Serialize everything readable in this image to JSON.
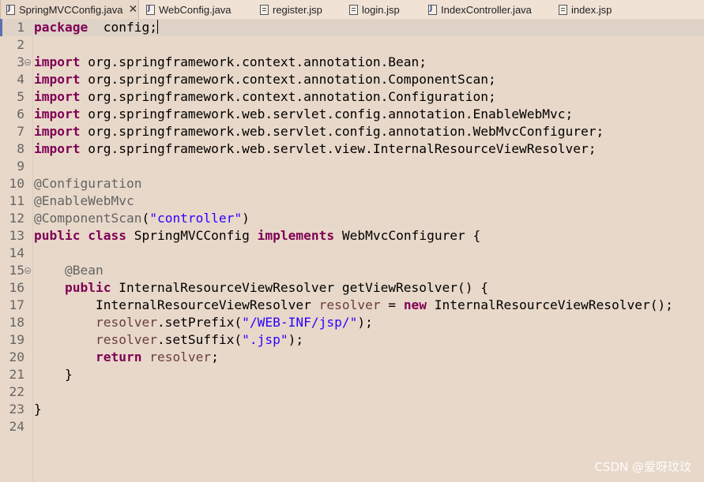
{
  "tabs": [
    {
      "label": "SpringMVCConfig.java",
      "type": "java",
      "active": true
    },
    {
      "label": "WebConfig.java",
      "type": "java"
    },
    {
      "label": "register.jsp",
      "type": "jsp"
    },
    {
      "label": "login.jsp",
      "type": "jsp"
    },
    {
      "label": "IndexController.java",
      "type": "java"
    },
    {
      "label": "index.jsp",
      "type": "jsp"
    }
  ],
  "close_symbol": "✕",
  "editor": {
    "lines": [
      {
        "n": "1",
        "current": true,
        "tokens": [
          [
            "kw",
            "package"
          ],
          [
            "",
            "  config;"
          ]
        ]
      },
      {
        "n": "2",
        "tokens": []
      },
      {
        "n": "3",
        "fold": true,
        "tokens": [
          [
            "kw",
            "import"
          ],
          [
            "",
            " org.springframework.context.annotation.Bean;"
          ]
        ]
      },
      {
        "n": "4",
        "tokens": [
          [
            "kw",
            "import"
          ],
          [
            "",
            " org.springframework.context.annotation.ComponentScan;"
          ]
        ]
      },
      {
        "n": "5",
        "tokens": [
          [
            "kw",
            "import"
          ],
          [
            "",
            " org.springframework.context.annotation.Configuration;"
          ]
        ]
      },
      {
        "n": "6",
        "tokens": [
          [
            "kw",
            "import"
          ],
          [
            "",
            " org.springframework.web.servlet.config.annotation.EnableWebMvc;"
          ]
        ]
      },
      {
        "n": "7",
        "tokens": [
          [
            "kw",
            "import"
          ],
          [
            "",
            " org.springframework.web.servlet.config.annotation.WebMvcConfigurer;"
          ]
        ]
      },
      {
        "n": "8",
        "tokens": [
          [
            "kw",
            "import"
          ],
          [
            "",
            " org.springframework.web.servlet.view.InternalResourceViewResolver;"
          ]
        ]
      },
      {
        "n": "9",
        "tokens": []
      },
      {
        "n": "10",
        "tokens": [
          [
            "ann",
            "@Configuration"
          ]
        ]
      },
      {
        "n": "11",
        "tokens": [
          [
            "ann",
            "@EnableWebMvc"
          ]
        ]
      },
      {
        "n": "12",
        "tokens": [
          [
            "ann",
            "@ComponentScan"
          ],
          [
            "",
            "("
          ],
          [
            "str",
            "\"controller\""
          ],
          [
            "",
            ")"
          ]
        ]
      },
      {
        "n": "13",
        "tokens": [
          [
            "kw",
            "public"
          ],
          [
            "",
            " "
          ],
          [
            "kw",
            "class"
          ],
          [
            "",
            " SpringMVCConfig "
          ],
          [
            "kw",
            "implements"
          ],
          [
            "",
            " WebMvcConfigurer {"
          ]
        ]
      },
      {
        "n": "14",
        "tokens": []
      },
      {
        "n": "15",
        "fold": true,
        "tokens": [
          [
            "",
            "    "
          ],
          [
            "ann",
            "@Bean"
          ]
        ]
      },
      {
        "n": "16",
        "tokens": [
          [
            "",
            "    "
          ],
          [
            "kw",
            "public"
          ],
          [
            "",
            " InternalResourceViewResolver getViewResolver() {"
          ]
        ]
      },
      {
        "n": "17",
        "tokens": [
          [
            "",
            "        InternalResourceViewResolver "
          ],
          [
            "var",
            "resolver"
          ],
          [
            "",
            " = "
          ],
          [
            "kw",
            "new"
          ],
          [
            "",
            " InternalResourceViewResolver();"
          ]
        ]
      },
      {
        "n": "18",
        "tokens": [
          [
            "",
            "        "
          ],
          [
            "var",
            "resolver"
          ],
          [
            "",
            ".setPrefix("
          ],
          [
            "str",
            "\"/WEB-INF/jsp/\""
          ],
          [
            "",
            ");"
          ]
        ]
      },
      {
        "n": "19",
        "tokens": [
          [
            "",
            "        "
          ],
          [
            "var",
            "resolver"
          ],
          [
            "",
            ".setSuffix("
          ],
          [
            "str",
            "\".jsp\""
          ],
          [
            "",
            ");"
          ]
        ]
      },
      {
        "n": "20",
        "tokens": [
          [
            "",
            "        "
          ],
          [
            "kw",
            "return"
          ],
          [
            "",
            " "
          ],
          [
            "var",
            "resolver"
          ],
          [
            "",
            ";"
          ]
        ]
      },
      {
        "n": "21",
        "tokens": [
          [
            "",
            "    }"
          ]
        ]
      },
      {
        "n": "22",
        "tokens": []
      },
      {
        "n": "23",
        "tokens": [
          [
            "",
            "}"
          ]
        ]
      },
      {
        "n": "24",
        "tokens": []
      }
    ]
  },
  "watermark": "CSDN @爱呀玟玟"
}
